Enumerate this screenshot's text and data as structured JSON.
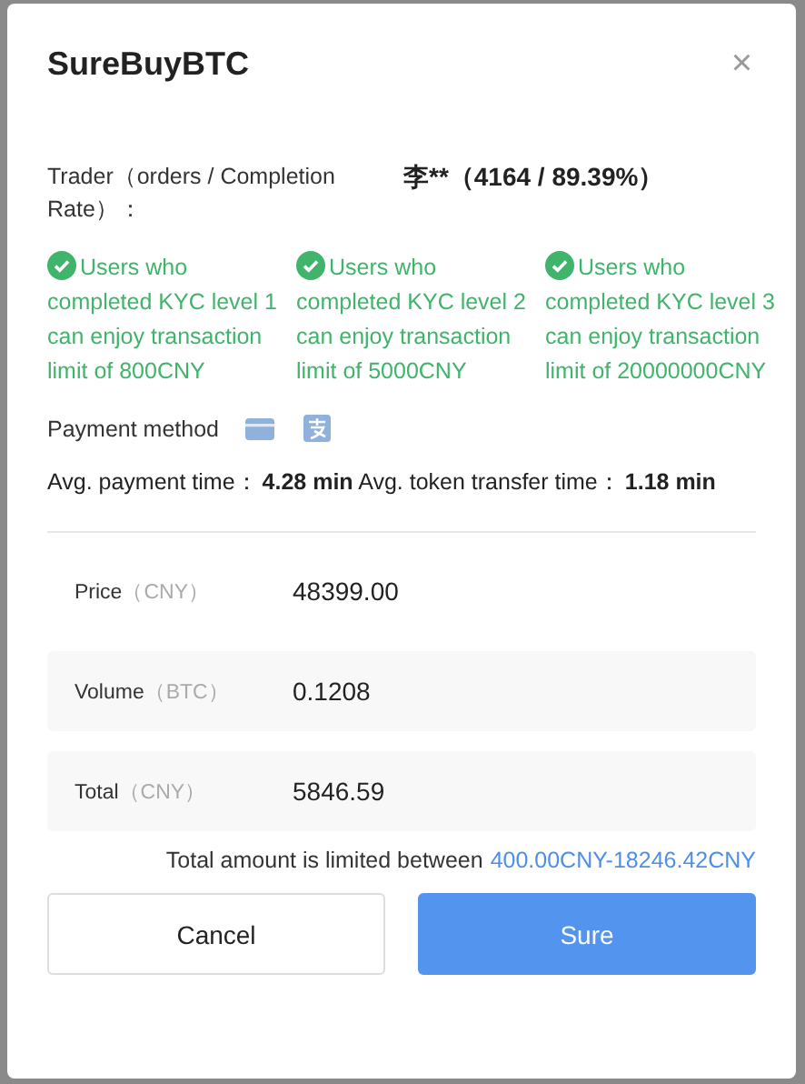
{
  "dialog": {
    "title": "SureBuyBTC",
    "close": "×"
  },
  "trader": {
    "label": "Trader（orders / Completion Rate）：",
    "value": "李**（4164 / 89.39%）"
  },
  "kyc_levels": [
    {
      "text": "Users who completed KYC level 1 can enjoy transaction limit of 800CNY"
    },
    {
      "text": "Users who completed KYC level 2 can enjoy transaction limit of 5000CNY"
    },
    {
      "text": "Users who completed KYC level 3 can enjoy transaction limit of 20000000CNY"
    }
  ],
  "payment": {
    "label": "Payment method",
    "methods": [
      {
        "kind": "card"
      },
      {
        "kind": "alipay"
      }
    ]
  },
  "times": {
    "payment_label": "Avg. payment time：",
    "payment_value": "4.28 min",
    "transfer_label": "Avg. token transfer time：",
    "transfer_value": "1.18 min"
  },
  "fields": [
    {
      "kind": "plain",
      "label": "Price",
      "unit": "（CNY）",
      "value": "48399.00"
    },
    {
      "kind": "filled",
      "label": "Volume",
      "unit": "（BTC）",
      "value": "0.1208"
    },
    {
      "kind": "filled",
      "label": "Total",
      "unit": "（CNY）",
      "value": "5846.59"
    }
  ],
  "limit": {
    "text": "Total amount is limited between",
    "range": "400.00CNY-18246.42CNY"
  },
  "buttons": [
    {
      "kind": "secondary",
      "label": "Cancel"
    },
    {
      "kind": "primary",
      "label": "Sure"
    }
  ]
}
